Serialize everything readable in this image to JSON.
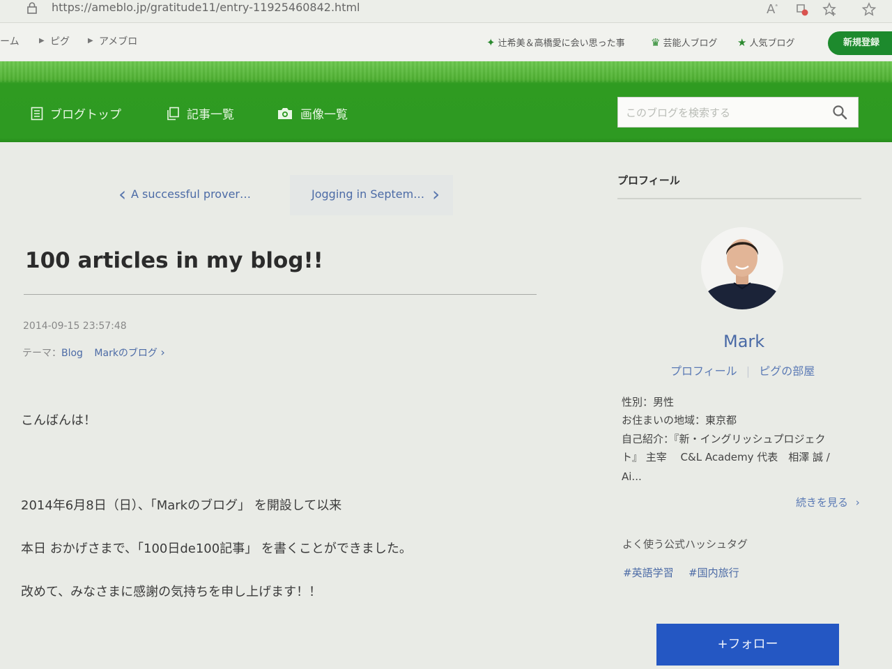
{
  "browser": {
    "url": "https://ameblo.jp/gratitude11/entry-11925460842.html",
    "icons": [
      "lock-icon",
      "read-aloud-icon",
      "tracking-icon",
      "favorite-add-icon",
      "favorites-icon"
    ]
  },
  "top_header": {
    "breadcrumbs": [
      "ーム",
      "ピグ",
      "アメブロ"
    ],
    "links": [
      {
        "label": "辻希美＆高橋愛に会い思った事",
        "icon": "sparkle-icon"
      },
      {
        "label": "芸能人ブログ",
        "icon": "crown-icon"
      },
      {
        "label": "人気ブログ",
        "icon": "star-icon"
      }
    ],
    "signup_label": "新規登録"
  },
  "blog_nav": {
    "items": [
      {
        "label": "ブログトップ",
        "icon": "document-icon"
      },
      {
        "label": "記事一覧",
        "icon": "copy-icon"
      },
      {
        "label": "画像一覧",
        "icon": "camera-icon"
      }
    ],
    "search_placeholder": "このブログを検索する"
  },
  "article": {
    "prev_label": "A successful prover…",
    "next_label": "Jogging in Septem…",
    "title": "100 articles in my blog!!",
    "datetime": "2014-09-15 23:57:48",
    "theme_prefix": "テーマ：",
    "theme_link": "Blog",
    "theme_blog": "Markのブログ",
    "paragraphs": [
      "こんばんは！",
      "2014年6月8日（日）、「Markのブログ」 を開設して以来",
      "本日 おかげさまで、「100日de100記事」 を書くことができました。",
      "改めて、みなさまに感謝の気持ちを申し上げます！！"
    ]
  },
  "sidebar": {
    "profile_heading": "プロフィール",
    "name": "Mark",
    "profile_link": "プロフィール",
    "pig_link": "ピグの部屋",
    "info": [
      "性別：男性",
      "お住まいの地域：東京都",
      "自己紹介：『新・イングリッシュプロジェク",
      "ト』 主宰　 C&L Academy 代表　相澤 誠 /",
      "Ai..."
    ],
    "more_label": "続きを見る",
    "hashtags_heading": "よく使う公式ハッシュタグ",
    "hashtags": [
      "#英語学習",
      "#国内旅行"
    ],
    "follow_label": "+フォロー"
  },
  "colors": {
    "brand_green": "#2e9a22",
    "link_blue": "#4c6ba6",
    "follow_blue": "#2457c3"
  }
}
